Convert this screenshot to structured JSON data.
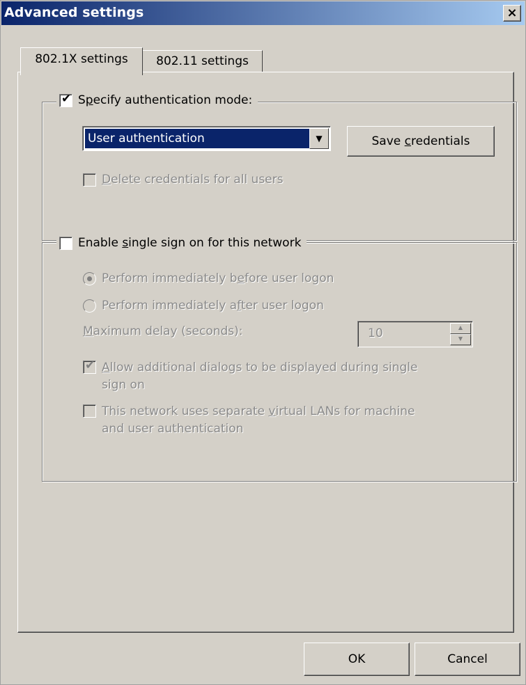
{
  "window": {
    "title": "Advanced settings",
    "close_glyph": "×"
  },
  "tabs": [
    {
      "label": "802.1X settings",
      "active": true
    },
    {
      "label": "802.11 settings",
      "active": false
    }
  ],
  "auth_group": {
    "specify_mode": {
      "label_before": "S",
      "label_accel": "p",
      "label_after": "ecify authentication mode:",
      "checked": true
    },
    "mode_select": {
      "value": "User authentication"
    },
    "save_credentials": {
      "label_before": "Save ",
      "label_accel": "c",
      "label_after": "redentials"
    },
    "delete_credentials": {
      "label_before": "",
      "label_accel": "D",
      "label_after": "elete credentials for all users",
      "checked": false,
      "disabled": true
    }
  },
  "sso_group": {
    "enable_sso": {
      "label_before": "Enable ",
      "label_accel": "s",
      "label_after": "ingle sign on for this network",
      "checked": false
    },
    "before_logon": {
      "label_before": "Perform immediately b",
      "label_accel": "e",
      "label_after": "fore user logon",
      "selected": true
    },
    "after_logon": {
      "label_before": "Perform immediately a",
      "label_accel": "f",
      "label_after": "ter user logon",
      "selected": false
    },
    "max_delay": {
      "label_before": "",
      "label_accel": "M",
      "label_after": "aximum delay (seconds):",
      "value": "10"
    },
    "allow_dialogs": {
      "label_line1_before": "",
      "label_accel": "A",
      "label_line1_after": "llow additional dialogs to be displayed during single",
      "label_line2": "sign on",
      "checked": true
    },
    "separate_vlans": {
      "label_line1_before": "This network uses separate ",
      "label_accel": "v",
      "label_line1_after": "irtual LANs for machine",
      "label_line2": "and user authentication",
      "checked": false
    }
  },
  "footer": {
    "ok_label": "OK",
    "cancel_label": "Cancel"
  },
  "colors": {
    "title_gradient_start": "#0a246a",
    "title_gradient_end": "#a6caf0",
    "dialog_bg": "#d4d0c8",
    "selection_bg": "#0a246a"
  }
}
